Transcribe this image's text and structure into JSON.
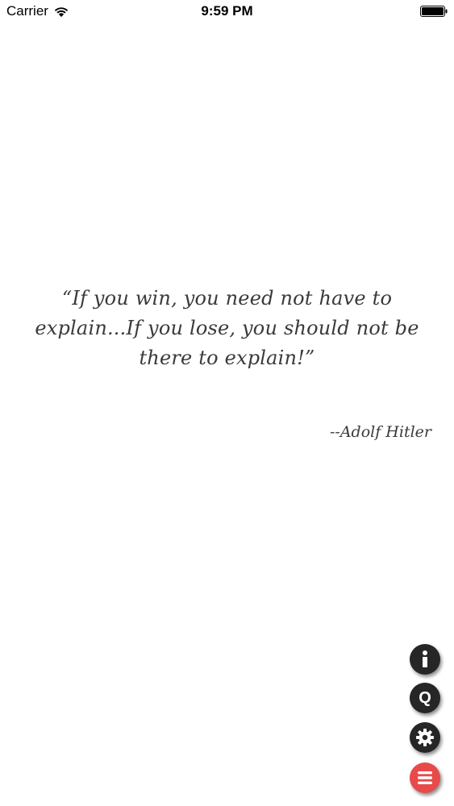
{
  "status_bar": {
    "carrier": "Carrier",
    "time": "9:59 PM"
  },
  "quote": {
    "text": "“If you win, you need not have to explain...If you lose, you should not be there to explain!”",
    "author": "--Adolf Hitler"
  },
  "action_buttons": {
    "info_icon": "info-icon",
    "quote_label": "Q",
    "settings_icon": "gear-icon",
    "menu_icon": "menu-icon"
  },
  "colors": {
    "button_dark": "#262626",
    "button_accent": "#e84a4a",
    "quote_text": "#3a3a3a"
  }
}
